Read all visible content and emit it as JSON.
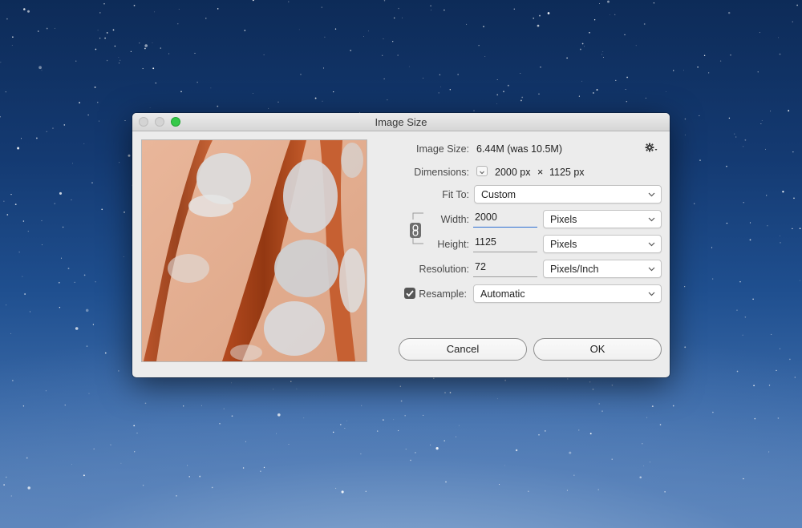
{
  "dialog": {
    "title": "Image Size",
    "image_size": {
      "label": "Image Size:",
      "value": "6.44M (was 10.5M)"
    },
    "dimensions": {
      "label": "Dimensions:",
      "width": "2000 px",
      "separator": "×",
      "height": "1125 px"
    },
    "fit_to": {
      "label": "Fit To:",
      "value": "Custom"
    },
    "width": {
      "label": "Width:",
      "value": "2000",
      "unit": "Pixels"
    },
    "height": {
      "label": "Height:",
      "value": "1125",
      "unit": "Pixels"
    },
    "resolution": {
      "label": "Resolution:",
      "value": "72",
      "unit": "Pixels/Inch"
    },
    "resample": {
      "label": "Resample:",
      "checked": true,
      "method": "Automatic"
    },
    "buttons": {
      "cancel": "Cancel",
      "ok": "OK"
    },
    "icons": {
      "gear": "gear-icon",
      "link": "link-icon",
      "chevron": "chevron-down-icon",
      "check": "checkmark-icon"
    },
    "colors": {
      "focus": "#2d6fd3",
      "close_zoom_green": "#35c94a"
    }
  }
}
